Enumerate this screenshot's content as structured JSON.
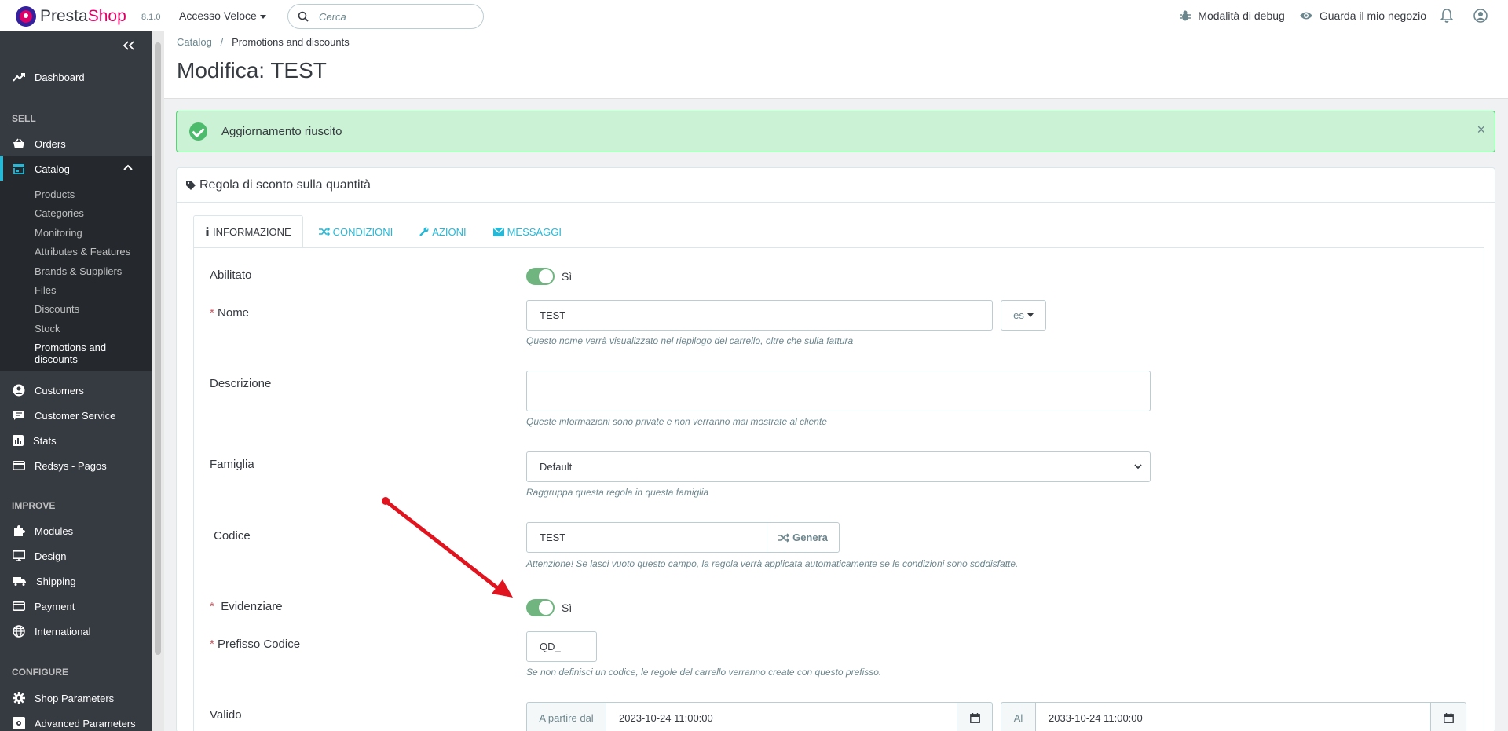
{
  "header": {
    "logo_prefix": "Presta",
    "logo_suffix": "Shop",
    "version": "8.1.0",
    "quick_access": "Accesso Veloce",
    "search_placeholder": "Cerca",
    "debug_mode": "Modalità di debug",
    "view_shop": "Guarda il mio negozio"
  },
  "sidebar": {
    "dashboard": "Dashboard",
    "sell_title": "SELL",
    "orders": "Orders",
    "catalog": "Catalog",
    "catalog_sub": [
      "Products",
      "Categories",
      "Monitoring",
      "Attributes & Features",
      "Brands & Suppliers",
      "Files",
      "Discounts",
      "Stock",
      "Promotions and discounts"
    ],
    "customers": "Customers",
    "customer_service": "Customer Service",
    "stats": "Stats",
    "redsys": "Redsys - Pagos",
    "improve_title": "IMPROVE",
    "modules": "Modules",
    "design": "Design",
    "shipping": "Shipping",
    "payment": "Payment",
    "international": "International",
    "configure_title": "CONFIGURE",
    "shop_parameters": "Shop Parameters",
    "advanced_parameters": "Advanced Parameters"
  },
  "breadcrumb": {
    "parent": "Catalog",
    "separator": "/",
    "current": "Promotions and discounts"
  },
  "page_title": "Modifica: TEST",
  "alert": {
    "message": "Aggiornamento riuscito",
    "close": "×"
  },
  "panel": {
    "title": "Regola di sconto sulla quantità",
    "tabs": [
      "INFORMAZIONE",
      "CONDIZIONI",
      "AZIONI",
      "MESSAGGI"
    ]
  },
  "form": {
    "enabled_label": "Abilitato",
    "enabled_value": "Sì",
    "required_mark": "*",
    "name_label": "Nome",
    "name_value": "TEST",
    "lang": "es",
    "name_help": "Questo nome verrà visualizzato nel riepilogo del carrello, oltre che sulla fattura",
    "description_label": "Descrizione",
    "description_value": "",
    "description_help": "Queste informazioni sono private e non verranno mai mostrate al cliente",
    "family_label": "Famiglia",
    "family_value": "Default",
    "family_help": "Raggruppa questa regola in questa famiglia",
    "code_label": "Codice",
    "code_value": "TEST",
    "generate": "Genera",
    "code_help": "Attenzione! Se lasci vuoto questo campo, la regola verrà applicata automaticamente se le condizioni sono soddisfatte.",
    "highlight_label": "Evidenziare",
    "highlight_value": "Sì",
    "prefix_label": "Prefisso Codice",
    "prefix_value": "QD_",
    "prefix_help": "Se non definisci un codice, le regole del carrello verranno create con questo prefisso.",
    "valid_label": "Valido",
    "from_label": "A partire dal",
    "from_value": "2023-10-24 11:00:00",
    "to_label": "Al",
    "to_value": "2033-10-24 11:00:00"
  },
  "colors": {
    "sidebar_bg": "#363a41",
    "accent": "#25b9d7",
    "brand_pink": "#df0067",
    "success_bg": "#cbf2d4",
    "toggle_on": "#70b580",
    "annotation_arrow": "#e0141e"
  }
}
